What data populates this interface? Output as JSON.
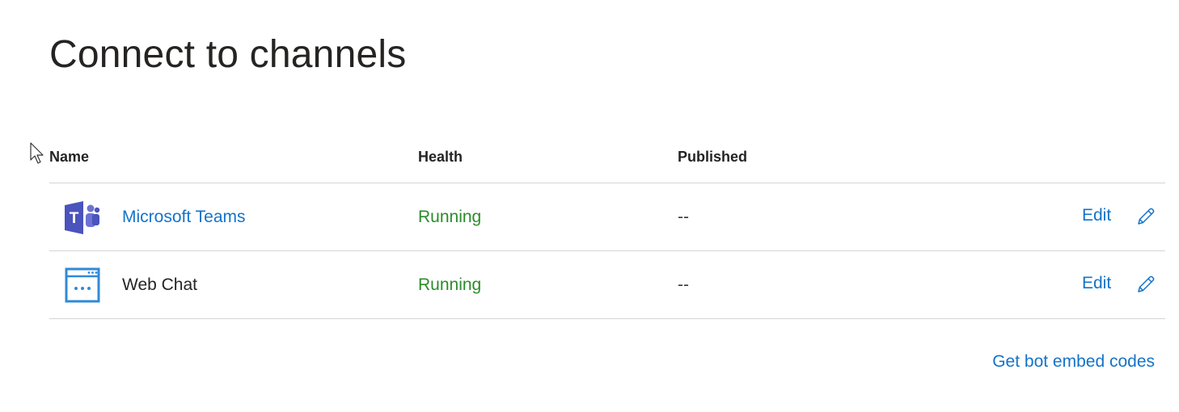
{
  "page": {
    "title": "Connect to channels"
  },
  "table": {
    "columns": {
      "name": "Name",
      "health": "Health",
      "published": "Published"
    },
    "rows": [
      {
        "icon": "microsoft-teams-icon",
        "name": "Microsoft Teams",
        "health": "Running",
        "published": "--",
        "edit": "Edit"
      },
      {
        "icon": "web-chat-icon",
        "name": "Web Chat",
        "health": "Running",
        "published": "--",
        "edit": "Edit"
      }
    ]
  },
  "footer": {
    "embed_link": "Get bot embed codes"
  },
  "colors": {
    "link": "#1473c8",
    "running": "#2c8c2c",
    "teams_brand": "#4b53bc",
    "webchat_brand": "#2f8ad8",
    "divider": "#d4d4d4"
  }
}
